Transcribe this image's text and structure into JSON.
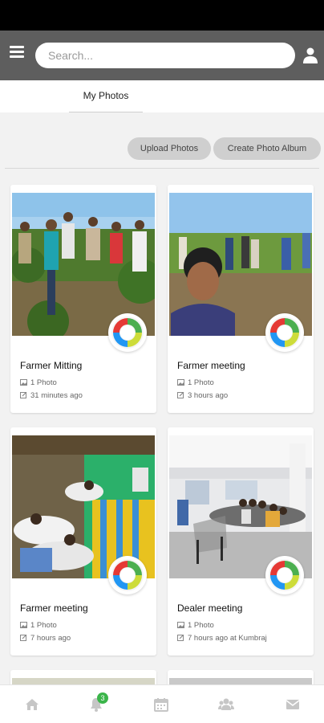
{
  "header": {
    "search_placeholder": "Search..."
  },
  "tabs": [
    {
      "label": "My Photos"
    }
  ],
  "toolbar": {
    "upload_label": "Upload Photos",
    "create_album_label": "Create Photo Album"
  },
  "albums": [
    {
      "title": "Farmer Mitting",
      "photo_count": "1 Photo",
      "time": "31 minutes ago"
    },
    {
      "title": "Farmer meeting",
      "photo_count": "1 Photo",
      "time": "3 hours ago"
    },
    {
      "title": "Farmer meeting",
      "photo_count": "1 Photo",
      "time": "7 hours ago"
    },
    {
      "title": "Dealer meeting",
      "photo_count": "1 Photo",
      "time": "7 hours ago at Kumbraj"
    }
  ],
  "bottom_nav": {
    "items": [
      "home-icon",
      "bell-icon",
      "calendar-icon",
      "group-icon",
      "mail-icon"
    ],
    "notification_badge": "3"
  },
  "colors": {
    "topbar": "#5e5e5e",
    "pill": "#cfcfcf",
    "badge": "#3bb54a",
    "nav_icon": "#c6c6c6"
  }
}
